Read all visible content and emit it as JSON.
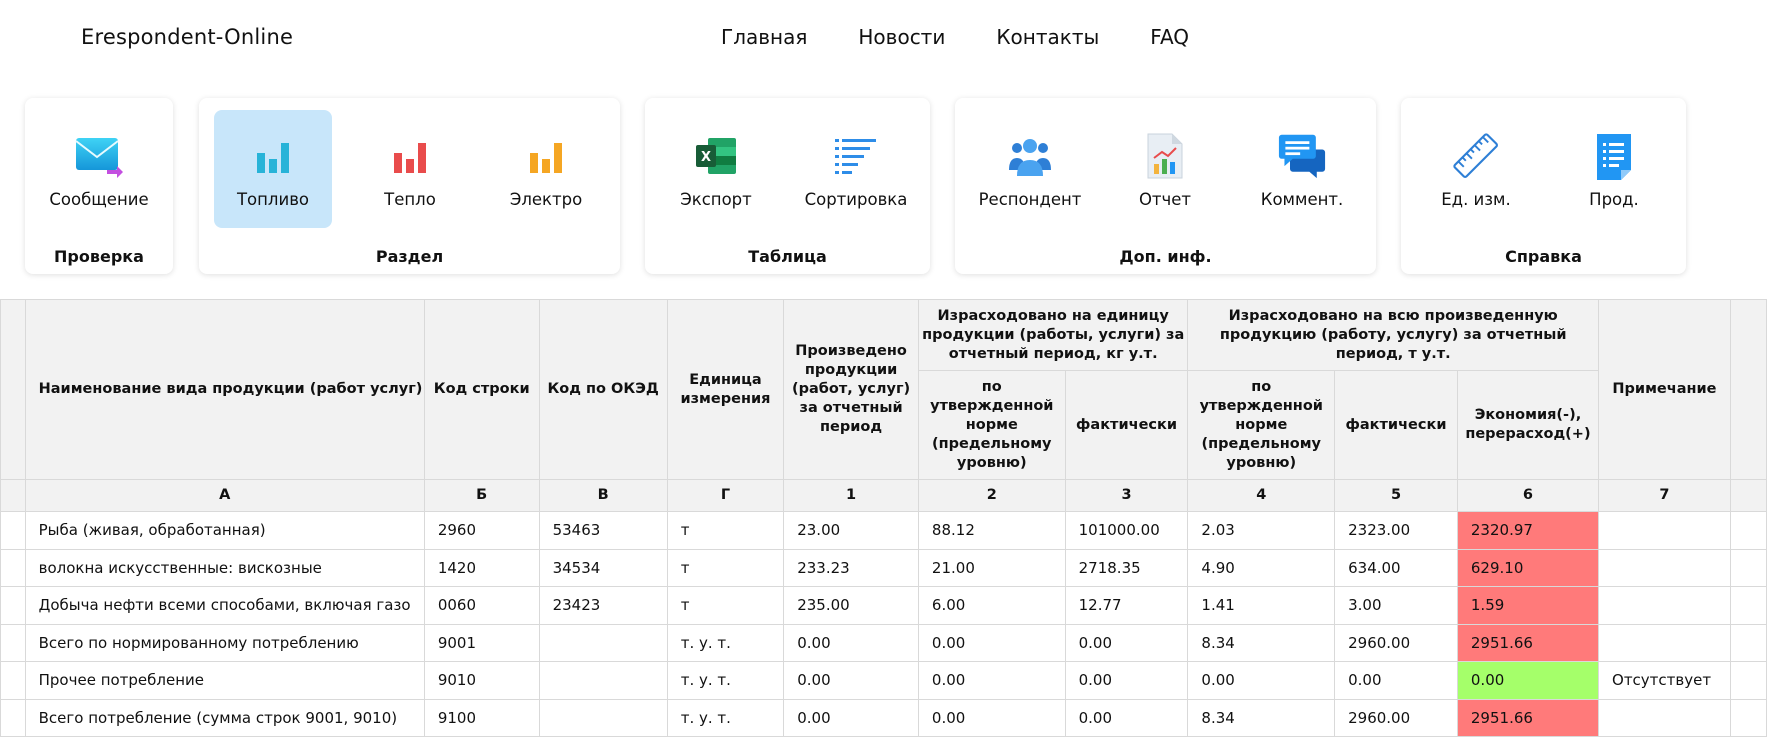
{
  "header": {
    "brand": "Erespondent-Online",
    "nav": [
      "Главная",
      "Новости",
      "Контакты",
      "FAQ"
    ]
  },
  "ribbon": {
    "groups": [
      {
        "title": "Проверка",
        "tools": [
          {
            "label": "Сообщение",
            "icon": "envelope-icon"
          }
        ]
      },
      {
        "title": "Раздел",
        "tools": [
          {
            "label": "Топливо",
            "icon": "bar-chart-blue-icon",
            "active": true
          },
          {
            "label": "Тепло",
            "icon": "bar-chart-red-icon"
          },
          {
            "label": "Электро",
            "icon": "bar-chart-orange-icon"
          }
        ]
      },
      {
        "title": "Таблица",
        "tools": [
          {
            "label": "Экспорт",
            "icon": "excel-icon"
          },
          {
            "label": "Сортировка",
            "icon": "sort-icon"
          }
        ]
      },
      {
        "title": "Доп. инф.",
        "tools": [
          {
            "label": "Респондент",
            "icon": "users-icon"
          },
          {
            "label": "Отчет",
            "icon": "report-icon"
          },
          {
            "label": "Коммент.",
            "icon": "comment-icon"
          }
        ]
      },
      {
        "title": "Справка",
        "tools": [
          {
            "label": "Ед. изм.",
            "icon": "ruler-icon"
          },
          {
            "label": "Прод.",
            "icon": "document-icon"
          }
        ]
      }
    ]
  },
  "table": {
    "headers": {
      "name": "Наименование вида продукции (работ услуг)",
      "row_code": "Код строки",
      "okved": "Код по ОКЭД",
      "unit": "Единица измерения",
      "produced": "Произведено продукции (работ, услуг) за отчетный период",
      "per_unit_group": "Израсходовано на единицу продукции (работы, услуги) за отчетный период, кг у.т.",
      "total_group": "Израсходовано на всю произведенную продукцию (работу, услугу) за отчетный период, т у.т.",
      "note": "Примечание",
      "norm": "по утвержденной норме (предельному уровню)",
      "actual": "фактически",
      "economy": "Экономия(-), перерасход(+)"
    },
    "letters": [
      "А",
      "Б",
      "В",
      "Г",
      "1",
      "2",
      "3",
      "4",
      "5",
      "6",
      "7"
    ],
    "rows": [
      {
        "name": "Рыба (живая, обработанная)",
        "code": "2960",
        "okved": "53463",
        "unit": "т",
        "c1": "23.00",
        "c2": "88.12",
        "c3": "101000.00",
        "c4": "2.03",
        "c5": "2323.00",
        "c6": "2320.97",
        "c6_status": "red",
        "note": ""
      },
      {
        "name": "волокна искусственные: вискозные",
        "code": "1420",
        "okved": "34534",
        "unit": "т",
        "c1": "233.23",
        "c2": "21.00",
        "c3": "2718.35",
        "c4": "4.90",
        "c5": "634.00",
        "c6": "629.10",
        "c6_status": "red",
        "note": ""
      },
      {
        "name": "Добыча нефти всеми способами, включая газо",
        "code": "0060",
        "okved": "23423",
        "unit": "т",
        "c1": "235.00",
        "c2": "6.00",
        "c3": "12.77",
        "c4": "1.41",
        "c5": "3.00",
        "c6": "1.59",
        "c6_status": "red",
        "note": ""
      },
      {
        "name": "Всего по нормированному потреблению",
        "code": "9001",
        "okved": "",
        "unit": "т. у. т.",
        "c1": "0.00",
        "c2": "0.00",
        "c3": "0.00",
        "c4": "8.34",
        "c5": "2960.00",
        "c6": "2951.66",
        "c6_status": "red",
        "note": ""
      },
      {
        "name": "Прочее потребление",
        "code": "9010",
        "okved": "",
        "unit": "т. у. т.",
        "c1": "0.00",
        "c2": "0.00",
        "c3": "0.00",
        "c4": "0.00",
        "c5": "0.00",
        "c6": "0.00",
        "c6_status": "green",
        "note": "Отсутствует"
      },
      {
        "name": "Всего потребление (сумма строк 9001, 9010)",
        "code": "9100",
        "okved": "",
        "unit": "т. у. т.",
        "c1": "0.00",
        "c2": "0.00",
        "c3": "0.00",
        "c4": "8.34",
        "c5": "2960.00",
        "c6": "2951.66",
        "c6_status": "red",
        "note": ""
      }
    ]
  },
  "colors": {
    "active_tool": "#c8e6fa",
    "overspend": "#ff7a7a",
    "economy": "#a5ff6a",
    "header_bg": "#f2f2f2"
  }
}
